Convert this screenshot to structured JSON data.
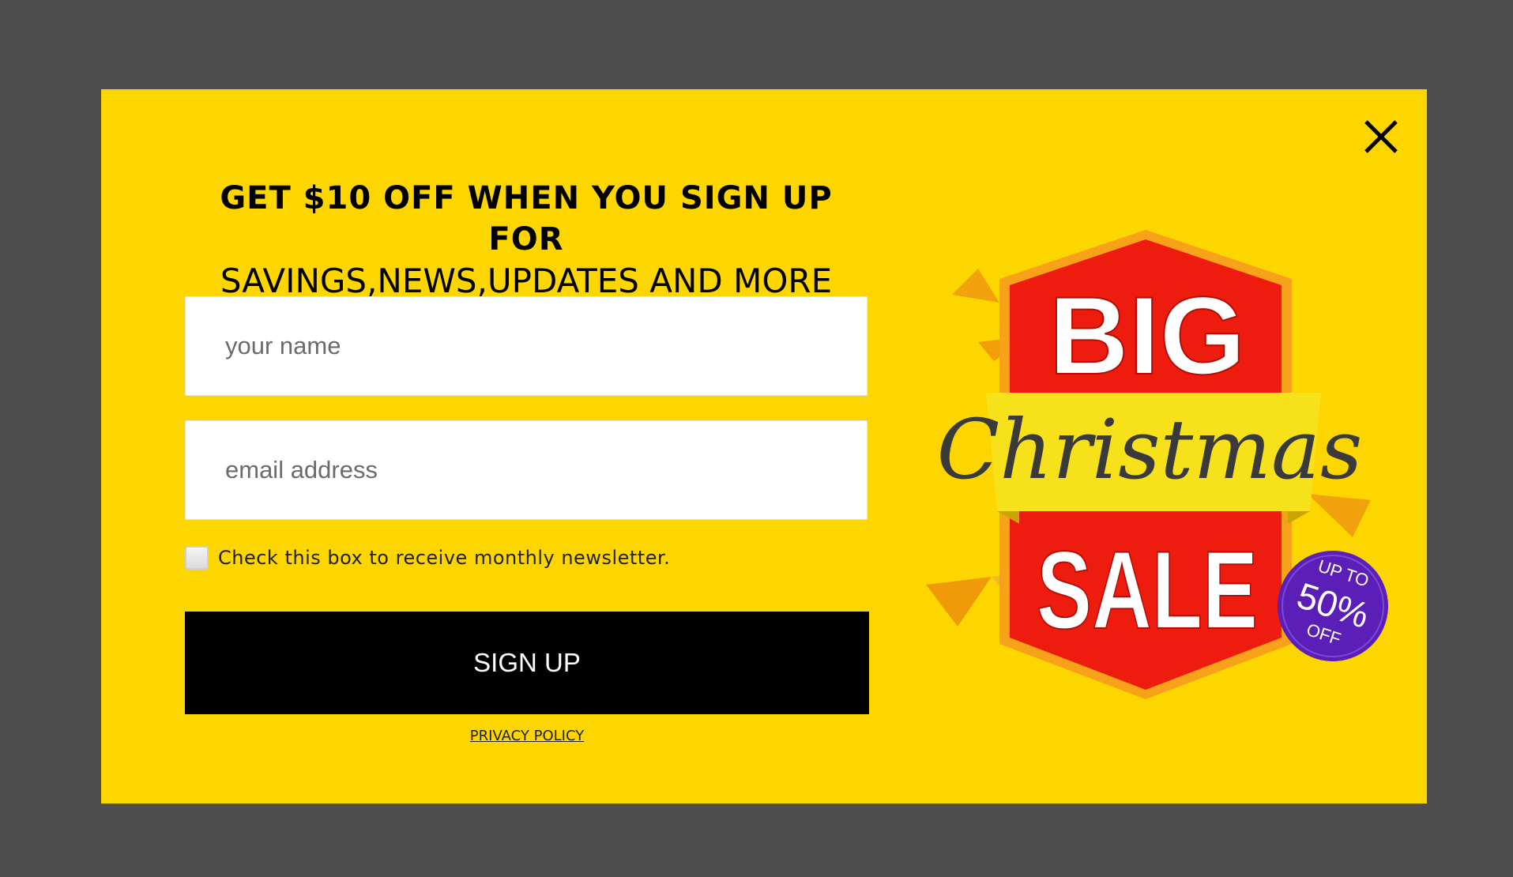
{
  "popup": {
    "headline_bold": "GET $10 OFF WHEN YOU SIGN UP FOR",
    "headline_regular": "SAVINGS,NEWS,UPDATES AND MORE",
    "name_placeholder": "your name",
    "email_placeholder": "email address",
    "newsletter_label": "Check this box to receive monthly newsletter.",
    "signup_label": "SIGN UP",
    "privacy_label": "PRIVACY POLICY",
    "close_icon": "close-icon"
  },
  "badge": {
    "line1": "BIG",
    "line2": "Christmas",
    "line3": "SALE",
    "discount_top": "UP TO",
    "discount_value": "50%",
    "discount_bottom": "OFF"
  },
  "colors": {
    "overlay": "#4d4d4d",
    "popup_background": "#fdd600",
    "button": "#000000",
    "badge_red": "#ee1c0e",
    "badge_purple": "#5b1fb8"
  }
}
